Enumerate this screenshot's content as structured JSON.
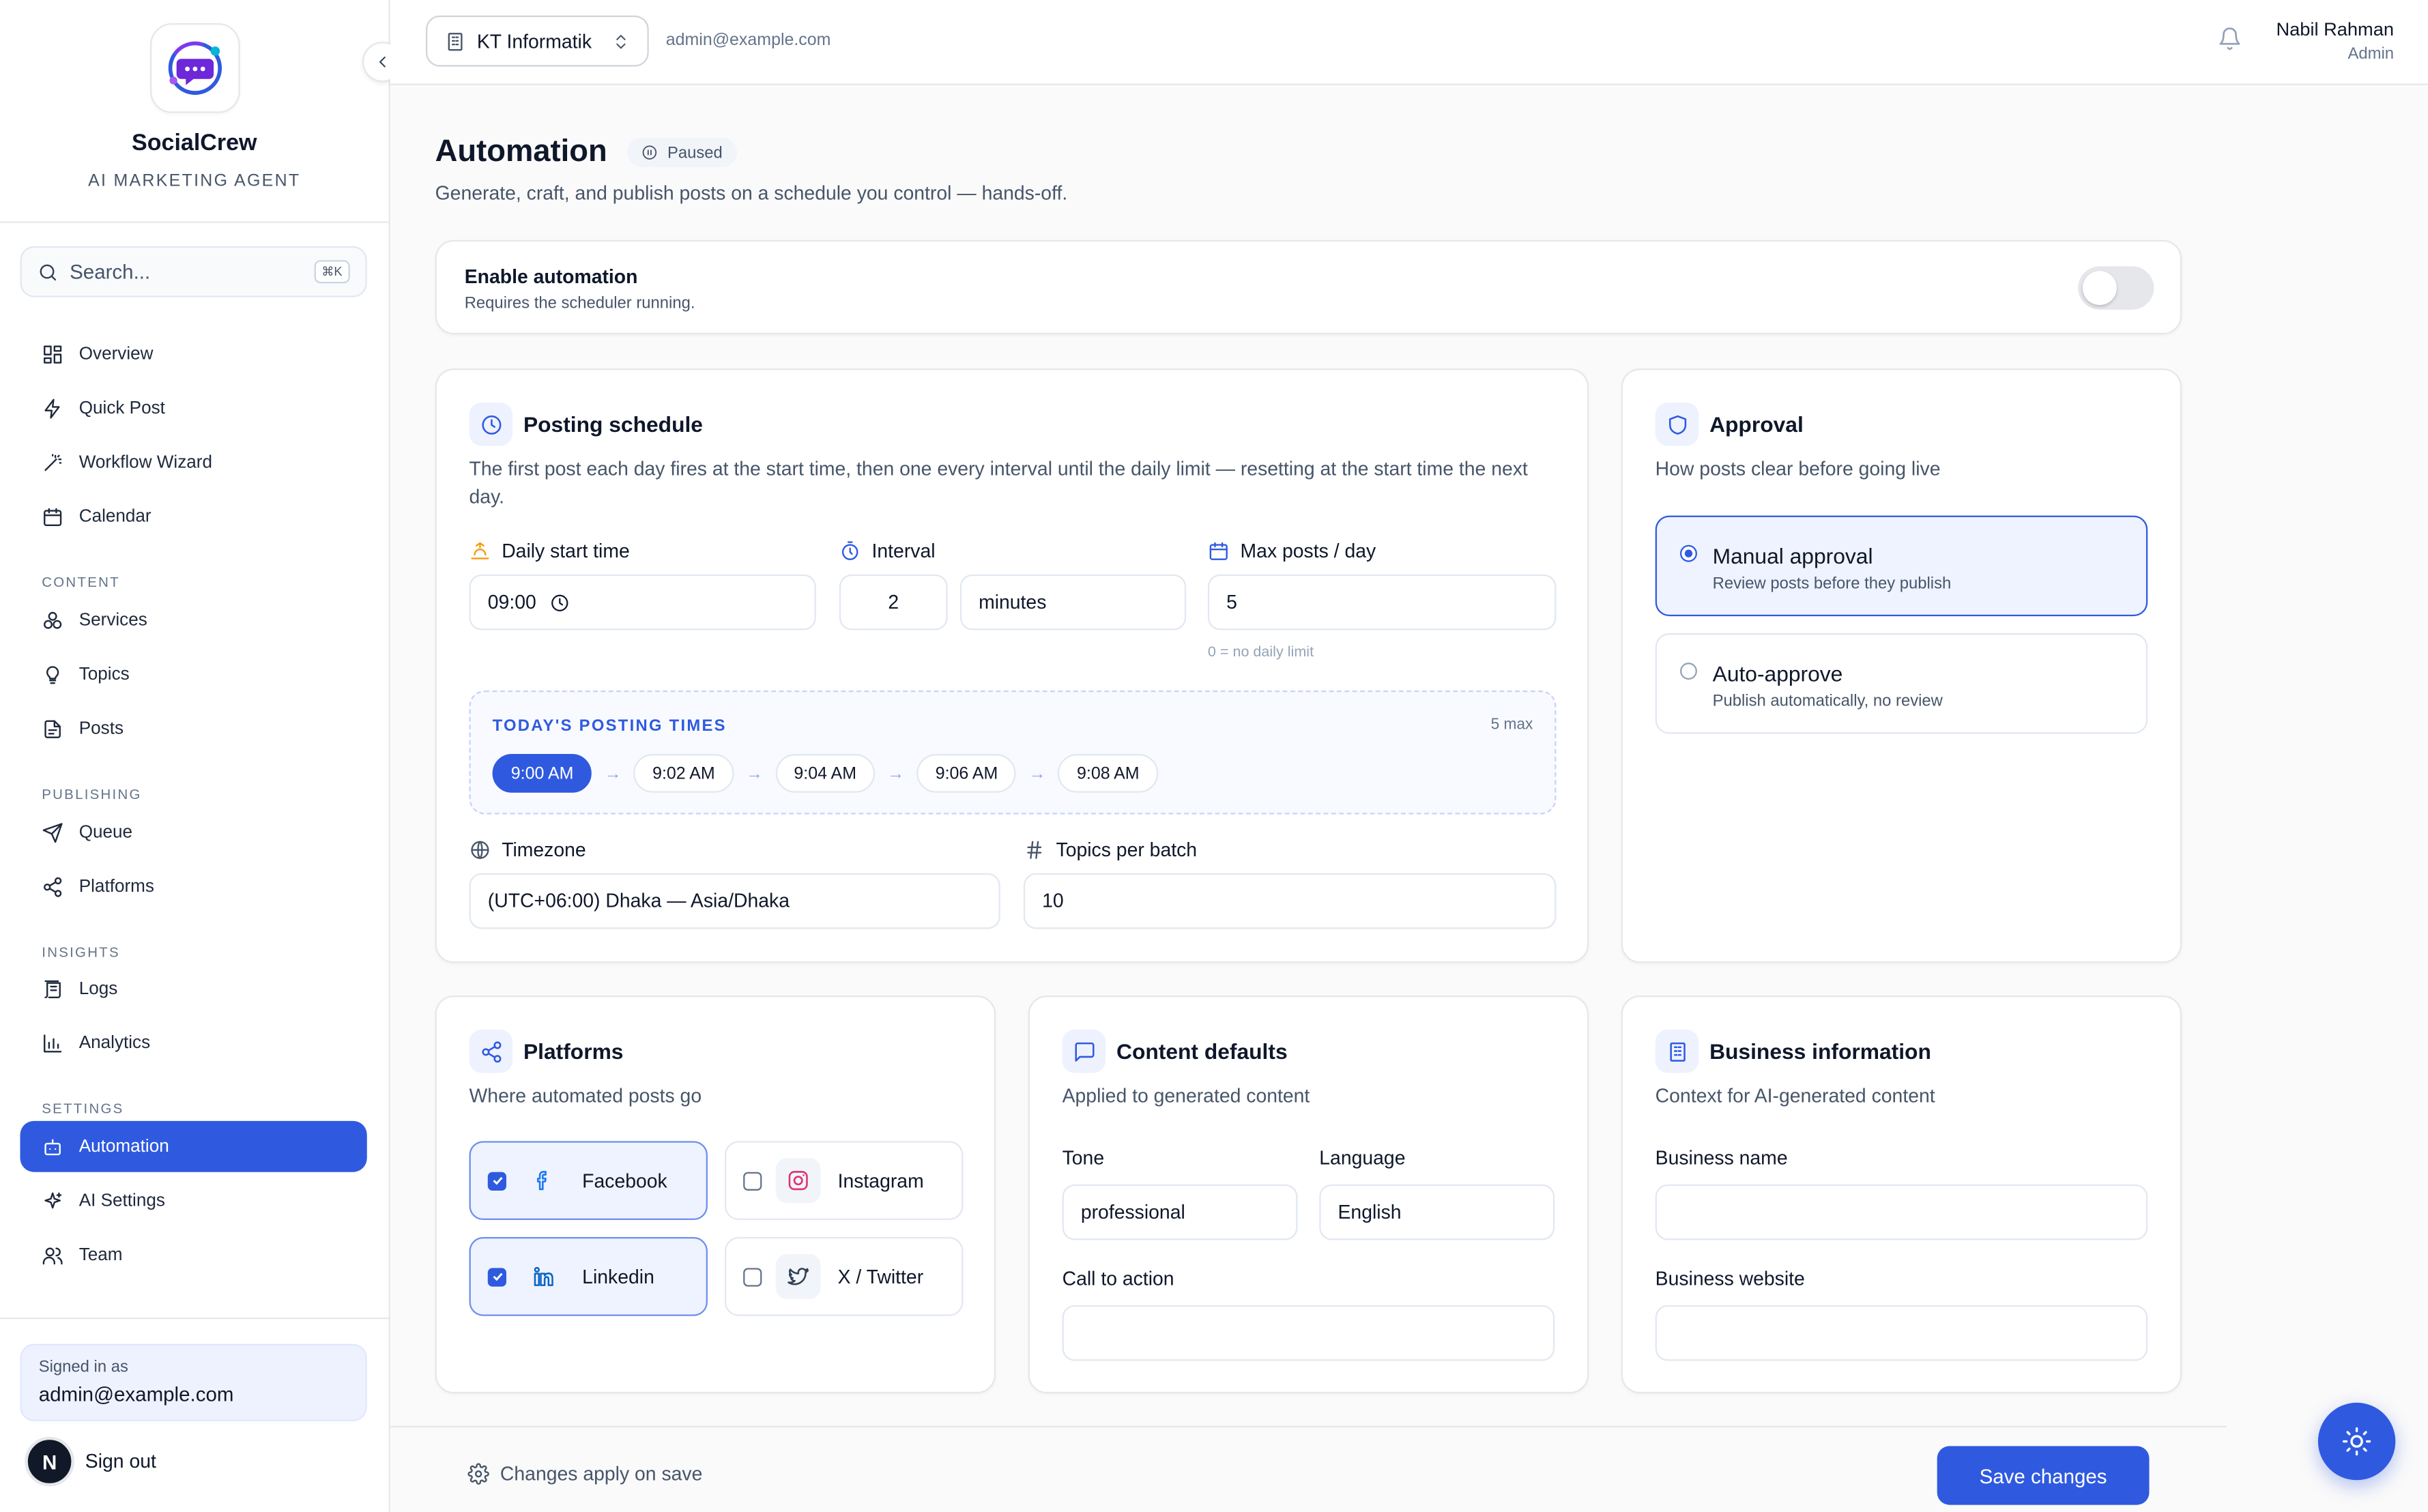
{
  "brand": {
    "name": "SocialCrew",
    "tagline": "AI MARKETING AGENT"
  },
  "search": {
    "placeholder": "Search...",
    "shortcut": "⌘K"
  },
  "nav": {
    "items": [
      {
        "label": "Overview",
        "icon": "dashboard-icon"
      },
      {
        "label": "Quick Post",
        "icon": "lightning-icon"
      },
      {
        "label": "Workflow Wizard",
        "icon": "magic-wand-icon"
      },
      {
        "label": "Calendar",
        "icon": "calendar-icon"
      }
    ],
    "content_label": "CONTENT",
    "content": [
      {
        "label": "Services",
        "icon": "cubes-icon"
      },
      {
        "label": "Topics",
        "icon": "lightbulb-icon"
      },
      {
        "label": "Posts",
        "icon": "document-icon"
      }
    ],
    "publishing_label": "PUBLISHING",
    "publishing": [
      {
        "label": "Queue",
        "icon": "send-icon"
      },
      {
        "label": "Platforms",
        "icon": "share-icon"
      }
    ],
    "insights_label": "INSIGHTS",
    "insights": [
      {
        "label": "Logs",
        "icon": "scroll-icon"
      },
      {
        "label": "Analytics",
        "icon": "bar-chart-icon"
      }
    ],
    "settings_label": "SETTINGS",
    "settings": [
      {
        "label": "Automation",
        "icon": "bot-icon",
        "active": true
      },
      {
        "label": "AI Settings",
        "icon": "sparkles-icon"
      },
      {
        "label": "Team",
        "icon": "users-icon"
      }
    ]
  },
  "account": {
    "signed_in_label": "Signed in as",
    "email": "admin@example.com",
    "avatar_letter": "N",
    "sign_out": "Sign out"
  },
  "topbar": {
    "org_name": "KT Informatik",
    "email": "admin@example.com",
    "user_name": "Nabil Rahman",
    "user_role": "Admin"
  },
  "page": {
    "title": "Automation",
    "status": "Paused",
    "subtitle": "Generate, craft, and publish posts on a schedule you control — hands-off."
  },
  "enable": {
    "title": "Enable automation",
    "subtitle": "Requires the scheduler running.",
    "enabled": false
  },
  "schedule": {
    "title": "Posting schedule",
    "description": "The first post each day fires at the start time, then one every interval until the daily limit — resetting at the start time the next day.",
    "start_label": "Daily start time",
    "start_value": "09:00",
    "interval_label": "Interval",
    "interval_value": "2",
    "interval_unit": "minutes",
    "max_label": "Max posts / day",
    "max_value": "5",
    "max_hint": "0 = no daily limit",
    "times_label": "TODAY'S POSTING TIMES",
    "times_max": "5 max",
    "times": [
      "9:00 AM",
      "9:02 AM",
      "9:04 AM",
      "9:06 AM",
      "9:08 AM"
    ],
    "timezone_label": "Timezone",
    "timezone_value": "(UTC+06:00) Dhaka — Asia/Dhaka",
    "topics_label": "Topics per batch",
    "topics_value": "10"
  },
  "approval": {
    "title": "Approval",
    "description": "How posts clear before going live",
    "options": [
      {
        "title": "Manual approval",
        "subtitle": "Review posts before they publish",
        "selected": true
      },
      {
        "title": "Auto-approve",
        "subtitle": "Publish automatically, no review",
        "selected": false
      }
    ]
  },
  "platforms": {
    "title": "Platforms",
    "description": "Where automated posts go",
    "items": [
      {
        "name": "Facebook",
        "checked": true,
        "color": "#1877f2"
      },
      {
        "name": "Instagram",
        "checked": false,
        "color": "#e1306c"
      },
      {
        "name": "Linkedin",
        "checked": true,
        "color": "#0a66c2"
      },
      {
        "name": "X / Twitter",
        "checked": false,
        "color": "#334155"
      }
    ]
  },
  "content_defaults": {
    "title": "Content defaults",
    "description": "Applied to generated content",
    "tone_label": "Tone",
    "tone_value": "professional",
    "language_label": "Language",
    "language_value": "English",
    "cta_label": "Call to action",
    "cta_value": ""
  },
  "business": {
    "title": "Business information",
    "description": "Context for AI-generated content",
    "name_label": "Business name",
    "name_value": "",
    "website_label": "Business website",
    "website_value": ""
  },
  "footer": {
    "note": "Changes apply on save",
    "save_label": "Save changes"
  },
  "colors": {
    "accent": "#2f5ae0",
    "active_nav": "#2f5ae0",
    "warning_icon": "#f59e0b"
  }
}
